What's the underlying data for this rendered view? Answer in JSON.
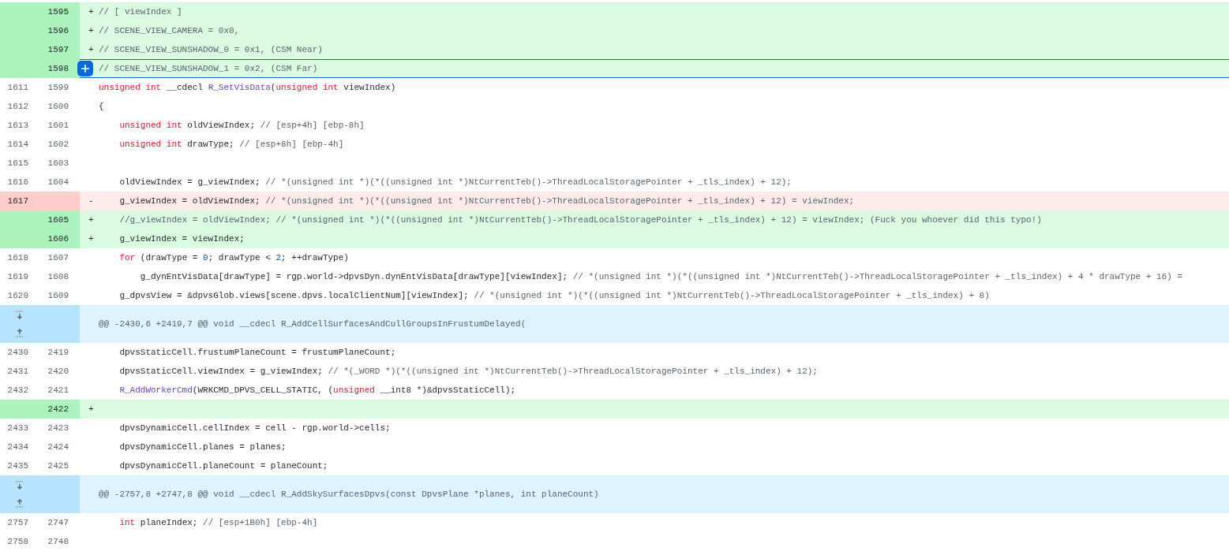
{
  "diff": {
    "rows": [
      {
        "kind": "added",
        "new": "1595",
        "marker": "+",
        "code": [
          {
            "kind": "comment",
            "text": "// [ viewIndex ]"
          }
        ]
      },
      {
        "kind": "added",
        "new": "1596",
        "marker": "+",
        "code": [
          {
            "kind": "comment",
            "text": "// SCENE_VIEW_CAMERA = 0x0,"
          }
        ]
      },
      {
        "kind": "added",
        "new": "1597",
        "marker": "+",
        "code": [
          {
            "kind": "comment",
            "text": "// SCENE_VIEW_SUNSHADOW_0 = 0x1, (CSM Near)"
          }
        ]
      },
      {
        "kind": "added",
        "new": "1598",
        "hovered": true,
        "code": [
          {
            "kind": "comment",
            "text": "// SCENE_VIEW_SUNSHADOW_1 = 0x2, (CSM Far)"
          }
        ]
      },
      {
        "kind": "context",
        "old": "1611",
        "new": "1599",
        "code": [
          {
            "kind": "keyword",
            "text": "unsigned int"
          },
          {
            "kind": "plain",
            "text": " __cdecl "
          },
          {
            "kind": "function",
            "text": "R_SetVisData"
          },
          {
            "kind": "plain",
            "text": "("
          },
          {
            "kind": "keyword",
            "text": "unsigned int"
          },
          {
            "kind": "plain",
            "text": " viewIndex)"
          }
        ]
      },
      {
        "kind": "context",
        "old": "1612",
        "new": "1600",
        "code": [
          {
            "kind": "plain",
            "text": "{"
          }
        ]
      },
      {
        "kind": "context",
        "old": "1613",
        "new": "1601",
        "code": [
          {
            "kind": "keyword",
            "text": "    unsigned int"
          },
          {
            "kind": "plain",
            "text": " oldViewIndex; "
          },
          {
            "kind": "comment",
            "text": "// [esp+4h] [ebp-8h]"
          }
        ]
      },
      {
        "kind": "context",
        "old": "1614",
        "new": "1602",
        "code": [
          {
            "kind": "keyword",
            "text": "    unsigned int"
          },
          {
            "kind": "plain",
            "text": " drawType; "
          },
          {
            "kind": "comment",
            "text": "// [esp+8h] [ebp-4h]"
          }
        ]
      },
      {
        "kind": "context",
        "old": "1615",
        "new": "1603"
      },
      {
        "kind": "context",
        "old": "1616",
        "new": "1604",
        "code": [
          {
            "kind": "plain",
            "text": "    oldViewIndex = g_viewIndex; "
          },
          {
            "kind": "comment",
            "text": "// *(unsigned int *)(*((unsigned int *)NtCurrentTeb()->ThreadLocalStoragePointer + _tls_index) + 12);"
          }
        ]
      },
      {
        "kind": "deleted",
        "old": "1617",
        "marker": "-",
        "code": [
          {
            "kind": "plain",
            "text": "    g_viewIndex = oldViewIndex; "
          },
          {
            "kind": "comment",
            "text": "// *(unsigned int *)(*((unsigned int *)NtCurrentTeb()->ThreadLocalStoragePointer + _tls_index) + 12) = viewIndex;"
          }
        ]
      },
      {
        "kind": "added",
        "new": "1605",
        "marker": "+",
        "code": [
          {
            "kind": "comment",
            "text": "    //g_viewIndex = oldViewIndex; // *(unsigned int *)(*((unsigned int *)NtCurrentTeb()->ThreadLocalStoragePointer + _tls_index) + 12) = viewIndex; (Fuck you whoever did this typo!)"
          }
        ]
      },
      {
        "kind": "added",
        "new": "1606",
        "marker": "+",
        "code": [
          {
            "kind": "plain",
            "text": "    g_viewIndex = viewIndex;"
          }
        ]
      },
      {
        "kind": "context",
        "old": "1618",
        "new": "1607",
        "code": [
          {
            "kind": "keyword",
            "text": "    for"
          },
          {
            "kind": "plain",
            "text": " (drawType = "
          },
          {
            "kind": "number",
            "text": "0"
          },
          {
            "kind": "plain",
            "text": "; drawType < "
          },
          {
            "kind": "number",
            "text": "2"
          },
          {
            "kind": "plain",
            "text": "; ++drawType)"
          }
        ]
      },
      {
        "kind": "context",
        "old": "1619",
        "new": "1608",
        "code": [
          {
            "kind": "plain",
            "text": "        g_dynEntVisData[drawType] = rgp.world->dpvsDyn.dynEntVisData[drawType][viewIndex]; "
          },
          {
            "kind": "comment",
            "text": "// *(unsigned int *)(*((unsigned int *)NtCurrentTeb()->ThreadLocalStoragePointer + _tls_index) + 4 * drawType + 16) ="
          }
        ]
      },
      {
        "kind": "context",
        "old": "1620",
        "new": "1609",
        "code": [
          {
            "kind": "plain",
            "text": "    g_dpvsView = &dpvsGlob.views[scene.dpvs.localClientNum][viewIndex]; "
          },
          {
            "kind": "comment",
            "text": "// *(unsigned int *)(*((unsigned int *)NtCurrentTeb()->ThreadLocalStoragePointer + _tls_index) + 8)"
          }
        ]
      },
      {
        "kind": "hunk",
        "header": "@@ -2430,6 +2419,7 @@ void __cdecl R_AddCellSurfacesAndCullGroupsInFrustumDelayed("
      },
      {
        "kind": "context",
        "old": "2430",
        "new": "2419",
        "code": [
          {
            "kind": "plain",
            "text": "    dpvsStaticCell.frustumPlaneCount = frustumPlaneCount;"
          }
        ]
      },
      {
        "kind": "context",
        "old": "2431",
        "new": "2420",
        "code": [
          {
            "kind": "plain",
            "text": "    dpvsStaticCell.viewIndex = g_viewIndex; "
          },
          {
            "kind": "comment",
            "text": "// *(_WORD *)(*((unsigned int *)NtCurrentTeb()->ThreadLocalStoragePointer + _tls_index) + 12);"
          }
        ]
      },
      {
        "kind": "context",
        "old": "2432",
        "new": "2421",
        "code": [
          {
            "kind": "function",
            "text": "    R_AddWorkerCmd"
          },
          {
            "kind": "plain",
            "text": "(WRKCMD_DPVS_CELL_STATIC, ("
          },
          {
            "kind": "keyword",
            "text": "unsigned"
          },
          {
            "kind": "plain",
            "text": " __int8 *)&dpvsStaticCell);"
          }
        ]
      },
      {
        "kind": "added",
        "new": "2422",
        "marker": "+"
      },
      {
        "kind": "context",
        "old": "2433",
        "new": "2423",
        "code": [
          {
            "kind": "plain",
            "text": "    dpvsDynamicCell.cellIndex = cell - rgp.world->cells;"
          }
        ]
      },
      {
        "kind": "context",
        "old": "2434",
        "new": "2424",
        "code": [
          {
            "kind": "plain",
            "text": "    dpvsDynamicCell.planes = planes;"
          }
        ]
      },
      {
        "kind": "context",
        "old": "2435",
        "new": "2425",
        "code": [
          {
            "kind": "plain",
            "text": "    dpvsDynamicCell.planeCount = planeCount;"
          }
        ]
      },
      {
        "kind": "hunk",
        "header": "@@ -2757,8 +2747,8 @@ void __cdecl R_AddSkySurfacesDpvs(const DpvsPlane *planes, int planeCount)"
      },
      {
        "kind": "context",
        "old": "2757",
        "new": "2747",
        "code": [
          {
            "kind": "keyword",
            "text": "    int"
          },
          {
            "kind": "plain",
            "text": " planeIndex; "
          },
          {
            "kind": "comment",
            "text": "// [esp+1B0h] [ebp-4h]"
          }
        ]
      },
      {
        "kind": "context",
        "old": "2758",
        "new": "2748"
      }
    ]
  }
}
